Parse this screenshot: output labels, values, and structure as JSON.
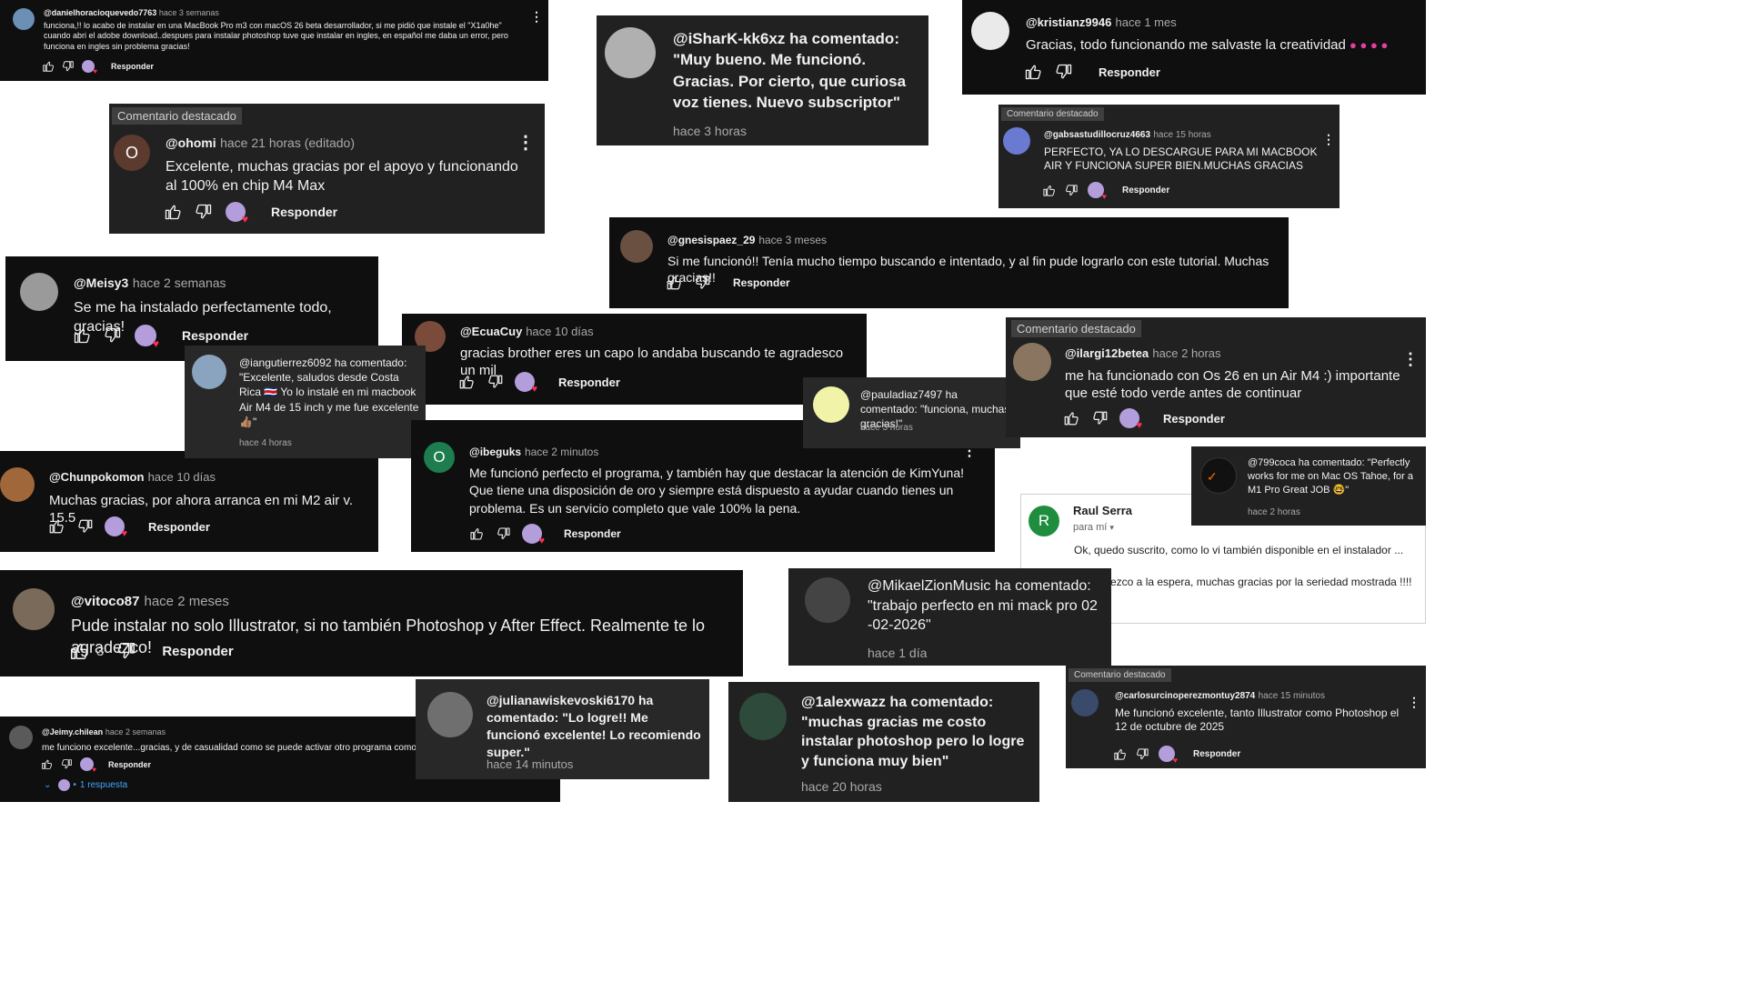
{
  "c1": {
    "user": "@danielhoracioquevedo7763",
    "time": "hace 3 semanas",
    "text": "funciona,!! lo acabo de instalar en una MacBook Pro m3 con macOS 26 beta desarrollador, si me pidió que instale el \"X1a0he\" cuando abri el adobe download..despues para instalar photoshop tuve que instalar en ingles, en español me daba un error, pero funciona en ingles sin problema gracias!",
    "reply": "Responder"
  },
  "c2": {
    "pinned": "Comentario destacado",
    "avatar_letter": "O",
    "user": "@ohomi",
    "time": "hace 21 horas (editado)",
    "text": "Excelente, muchas gracias por el apoyo y funcionando al 100% en chip M4 Max",
    "reply": "Responder"
  },
  "c3": {
    "user": "@Meisy3",
    "time": "hace 2 semanas",
    "text": "Se me ha instalado perfectamente todo, gracias!",
    "reply": "Responder"
  },
  "c4": {
    "text": "@iangutierrez6092 ha comentado: \"Excelente, saludos desde Costa Rica 🇨🇷 Yo lo instalé en mi macbook Air M4 de 15 inch y me fue excelente 👍🏽\"",
    "time": "hace 4 horas"
  },
  "c5": {
    "user": "@Chunpokomon",
    "time": "hace 10 días",
    "text": "Muchas gracias, por ahora arranca en mi M2 air v. 15.5",
    "reply": "Responder"
  },
  "c6": {
    "user": "@vitoco87",
    "time": "hace 2 meses",
    "text": "Pude instalar no solo Illustrator, si no también Photoshop y After Effect. Realmente te lo agradezco!",
    "likes": "3",
    "reply": "Responder"
  },
  "c7": {
    "user": "@Jeimy.chilean",
    "time": "hace 2 semanas",
    "text": "me funciono excelente...gracias, y de casualidad como se puede activar otro programa como el ligth",
    "reply": "Responder",
    "replies": "1 respuesta"
  },
  "c8": {
    "text": "@iSharK-kk6xz ha comentado: \"Muy bueno. Me funcionó. Gracias. Por cierto, que curiosa voz tienes. Nuevo subscriptor\"",
    "time": "hace 3 horas"
  },
  "c9": {
    "user": "@EcuaCuy",
    "time": "hace 10 días",
    "text": "gracias brother eres un capo lo andaba buscando te agradesco un mil",
    "reply": "Responder"
  },
  "c10": {
    "avatar_letter": "O",
    "user": "@ibeguks",
    "time": "hace 2 minutos",
    "text": "Me funcionó perfecto el programa, y también hay que destacar la atención de KimYuna! Que tiene una disposición de oro y siempre está dispuesto a ayudar cuando tienes un problema. Es un servicio completo que vale 100% la pena.",
    "reply": "Responder"
  },
  "c11": {
    "text": "@julianawiskevoski6170 ha comentado: \"Lo logre!! Me funcionó excelente! Lo recomiendo super.\"",
    "time": "hace 14 minutos"
  },
  "c12": {
    "text": "@1alexwazz ha comentado: \"muchas gracias me costo instalar photoshop pero lo logre y funciona muy bien\"",
    "time": "hace 20 horas"
  },
  "c13": {
    "user": "@kristianz9946",
    "time": "hace 1 mes",
    "text": "Gracias, todo funcionando me salvaste la creatividad",
    "reply": "Responder"
  },
  "c14": {
    "pinned": "Comentario destacado",
    "user": "@gabsastudillocruz4663",
    "time": "hace 15 horas",
    "text": "PERFECTO, YA LO DESCARGUE PARA MI MACBOOK AIR Y FUNCIONA SUPER BIEN.MUCHAS GRACIAS",
    "reply": "Responder"
  },
  "c15": {
    "user": "@gnesispaez_29",
    "time": "hace 3 meses",
    "text": "Si me funcionó!! Tenía mucho tiempo buscando e intentado, y al fin pude lograrlo con este tutorial. Muchas gracias!!",
    "reply": "Responder"
  },
  "c16": {
    "text": "@pauladiaz7497 ha comentado: \"funciona, muchas gracias!\"",
    "time": "hace 3 horas"
  },
  "c17": {
    "pinned": "Comentario destacado",
    "user": "@ilargi12betea",
    "time": "hace 2 horas",
    "text": "me ha funcionado con Os 26 en un Air M4 :) importante que esté todo verde antes de continuar",
    "reply": "Responder"
  },
  "c18": {
    "text": "@799coca ha comentado: \"Perfectly works for me on Mac OS Tahoe, for a M1 Pro Great JOB 🤓\"",
    "time": "hace 2 horas"
  },
  "c19": {
    "avatar_letter": "R",
    "name": "Raul Serra",
    "to": "para mí",
    "line1": "Ok, quedo suscrito, como lo vi también disponible en el instalador ...",
    "line2": "ezco a la espera, muchas gracias por la seriedad mostrada !!!!"
  },
  "c20": {
    "text": "@MikaelZionMusic ha comentado: \"trabajo perfecto en mi mack pro 02 -02-2026\"",
    "time": "hace 1 día"
  },
  "c21": {
    "pinned": "Comentario destacado",
    "user": "@carlosurcinoperezmontuy2874",
    "time": "hace 15 minutos",
    "text": "Me funcionó excelente, tanto Illustrator como Photoshop el 12 de octubre de 2025",
    "reply": "Responder"
  },
  "colors": {
    "background": "#0f0f0f",
    "card_gray": "#282828",
    "heart": "#ff2d55",
    "green_avatar": "#1e7d4f",
    "creator_avatar": "#b39ddb"
  }
}
